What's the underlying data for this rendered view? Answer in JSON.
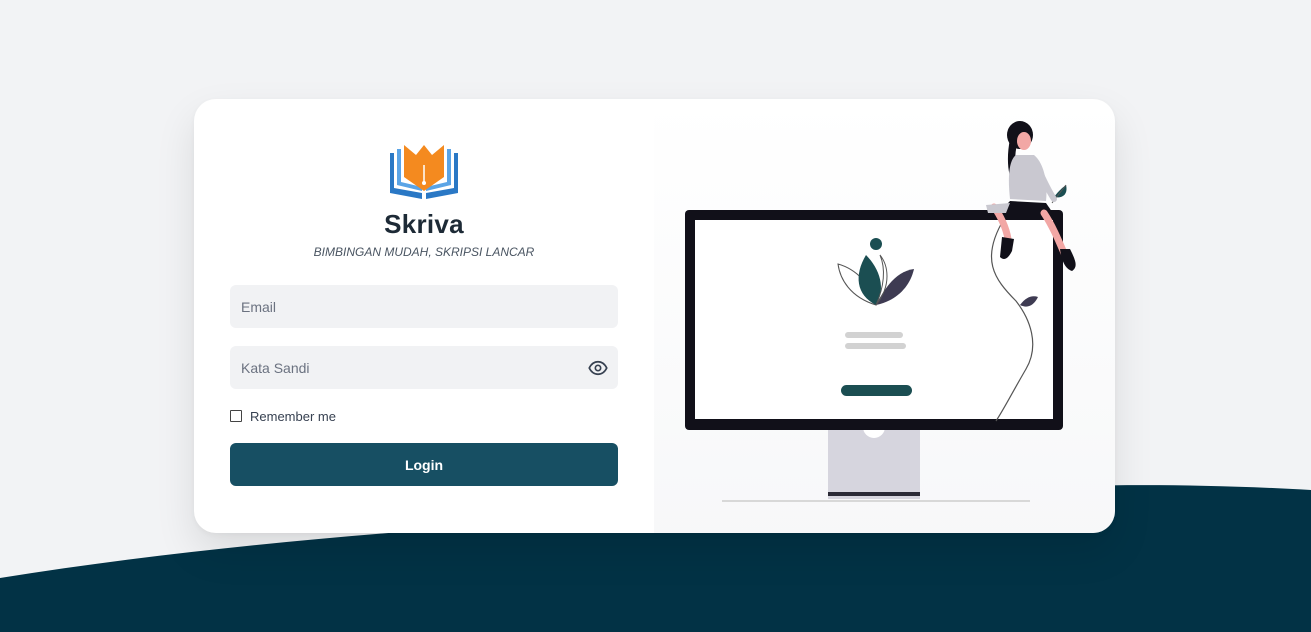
{
  "brand": {
    "name": "Skriva",
    "tagline": "BIMBINGAN MUDAH, SKRIPSI LANCAR"
  },
  "form": {
    "email_placeholder": "Email",
    "password_placeholder": "Kata Sandi",
    "remember_label": "Remember me",
    "remember_checked": false,
    "login_label": "Login"
  },
  "icons": {
    "logo": "open-book-pen-icon",
    "password_toggle": "eye-icon"
  },
  "colors": {
    "page_background": "#f2f3f5",
    "wave": "#023245",
    "primary_button": "#174f63",
    "logo_orange": "#f48a1f",
    "logo_blue": "#2a78c5"
  }
}
